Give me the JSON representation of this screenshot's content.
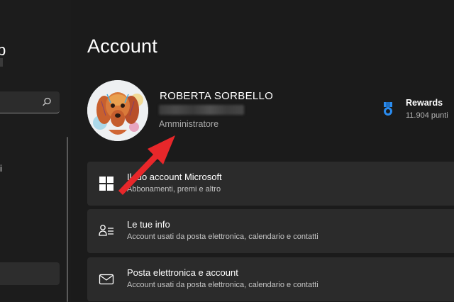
{
  "sidebar": {
    "fragment_text": "b",
    "item_fragment": "i"
  },
  "page": {
    "title": "Account"
  },
  "profile": {
    "name": "ROBERTA SORBELLO",
    "role": "Amministratore"
  },
  "rewards": {
    "title": "Rewards",
    "points": "11.904 punti"
  },
  "cards": [
    {
      "title": "Il tuo account Microsoft",
      "subtitle": "Abbonamenti, premi e altro",
      "icon": "windows-logo-icon"
    },
    {
      "title": "Le tue info",
      "subtitle": "Account usati da posta elettronica, calendario e contatti",
      "icon": "person-info-icon"
    },
    {
      "title": "Posta elettronica e account",
      "subtitle": "Account usati da posta elettronica, calendario e contatti",
      "icon": "mail-icon"
    }
  ],
  "colors": {
    "background": "#1b1b1b",
    "card": "#2b2b2b",
    "accent_blue": "#2a8cf0",
    "arrow_red": "#e8272a"
  }
}
